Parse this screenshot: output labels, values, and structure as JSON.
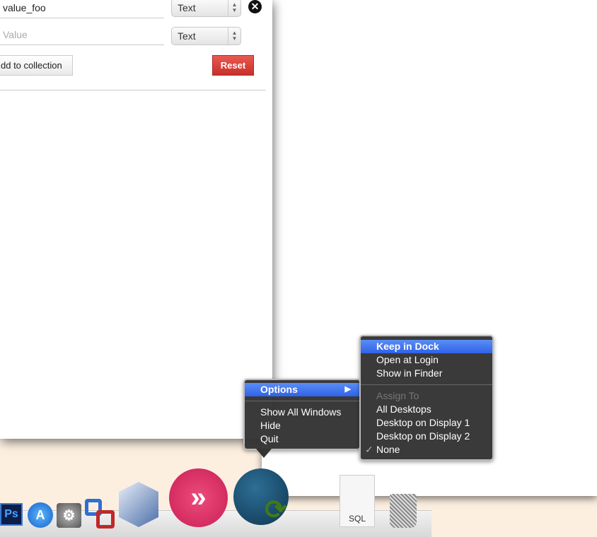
{
  "form": {
    "row1_value": "value_foo",
    "row1_type": "Text",
    "row2_placeholder": "Value",
    "row2_type": "Text",
    "add_label": "dd to collection",
    "reset_label": "Reset",
    "reset_color": "#d23b33"
  },
  "context_menu": {
    "options": "Options",
    "show_all": "Show All Windows",
    "hide": "Hide",
    "quit": "Quit"
  },
  "submenu": {
    "keep": "Keep in Dock",
    "open_login": "Open at Login",
    "show_finder": "Show in Finder",
    "assign_to": "Assign To",
    "all_desktops": "All Desktops",
    "display1": "Desktop on Display 1",
    "display2": "Desktop on Display 2",
    "none": "None",
    "checkmark": "✓"
  },
  "dock": {
    "ps": "Ps",
    "sql": "SQL",
    "highlight_color": "#3a6ff0"
  }
}
